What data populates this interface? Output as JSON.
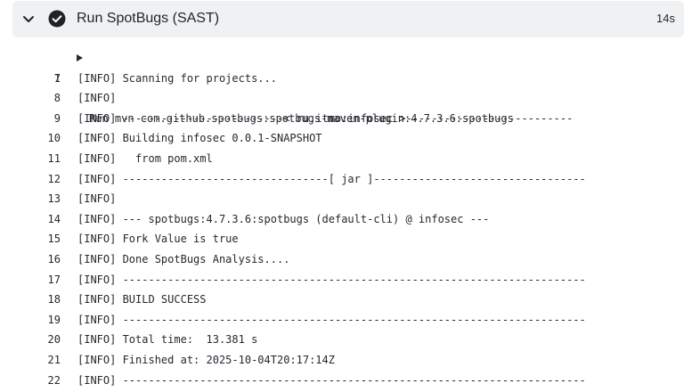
{
  "step": {
    "title": "Run SpotBugs (SAST)",
    "duration": "14s",
    "status": "success",
    "expand_icon": "chevron-down-icon",
    "status_icon": "check-circle-icon"
  },
  "colors": {
    "header_background": "#f0f1f3",
    "success_icon": "#1f2328",
    "text": "#24292f"
  },
  "log": {
    "command": {
      "number": "1",
      "text": "Run mvn com.github.spotbugs:spotbugs-maven-plugin:4.7.3.6:spotbugs"
    },
    "lines": [
      {
        "number": "7",
        "text": "[INFO] Scanning for projects..."
      },
      {
        "number": "8",
        "text": "[INFO]"
      },
      {
        "number": "9",
        "text": "[INFO] -------------------------< ru.itmo:infosec >--------------------------"
      },
      {
        "number": "10",
        "text": "[INFO] Building infosec 0.0.1-SNAPSHOT"
      },
      {
        "number": "11",
        "text": "[INFO]   from pom.xml"
      },
      {
        "number": "12",
        "text": "[INFO] --------------------------------[ jar ]---------------------------------"
      },
      {
        "number": "13",
        "text": "[INFO]"
      },
      {
        "number": "14",
        "text": "[INFO] --- spotbugs:4.7.3.6:spotbugs (default-cli) @ infosec ---"
      },
      {
        "number": "15",
        "text": "[INFO] Fork Value is true"
      },
      {
        "number": "16",
        "text": "[INFO] Done SpotBugs Analysis...."
      },
      {
        "number": "17",
        "text": "[INFO] ------------------------------------------------------------------------"
      },
      {
        "number": "18",
        "text": "[INFO] BUILD SUCCESS"
      },
      {
        "number": "19",
        "text": "[INFO] ------------------------------------------------------------------------"
      },
      {
        "number": "20",
        "text": "[INFO] Total time:  13.381 s"
      },
      {
        "number": "21",
        "text": "[INFO] Finished at: 2025-10-04T20:17:14Z"
      },
      {
        "number": "22",
        "text": "[INFO] ------------------------------------------------------------------------"
      }
    ]
  }
}
